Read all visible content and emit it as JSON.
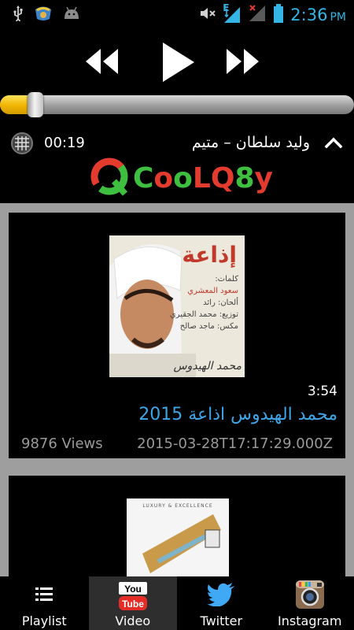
{
  "status_bar": {
    "time": "2:36",
    "ampm": "PM",
    "network": "E",
    "icons": [
      "usb-icon",
      "game-icon",
      "android-icon",
      "mute-icon",
      "signal-icon",
      "battery-icon"
    ]
  },
  "player": {
    "progress": 0.1,
    "elapsed": "00:19",
    "now_playing": "وليد سلطان – متيم",
    "controls": [
      "rewind-icon",
      "play-icon",
      "fast-forward-icon"
    ]
  },
  "banner": {
    "text": "CooLQ8y"
  },
  "videos": [
    {
      "duration": "3:54",
      "title": "محمد الهيدوس اذاعة 2015",
      "views": "9876 Views",
      "published": "2015-03-28T17:17:29.000Z",
      "thumb_text": {
        "headline": "إذاعة",
        "lines": [
          "كلمات:",
          "سعود المعشري",
          "ألحان: رائد",
          "توزيع: محمد الجقيري",
          "مكس: ماجد صالح"
        ],
        "artist": "محمد الهيدوس"
      }
    },
    {
      "duration": "",
      "title": "",
      "views": "",
      "published": "",
      "thumb_text": {
        "headline": "LUXURY & EXCELLENCE"
      }
    }
  ],
  "bottom_nav": {
    "tabs": [
      {
        "label": "Playlist",
        "icon": "list-icon"
      },
      {
        "label": "Video",
        "icon": "youtube-icon"
      },
      {
        "label": "Twitter",
        "icon": "twitter-bird-icon"
      },
      {
        "label": "Instagram",
        "icon": "instagram-icon"
      }
    ],
    "active": "Video"
  },
  "colors": {
    "accent": "#33b5e5",
    "title_blue": "#3ea6e8",
    "seek_fill": "#f0b400",
    "feed_bg": "#9e9e9e"
  }
}
